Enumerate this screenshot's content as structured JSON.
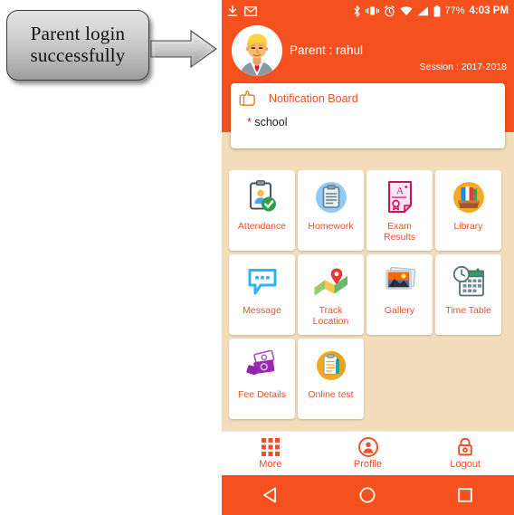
{
  "annotation": {
    "callout_text": "Parent login successfully",
    "arrow": "right-arrow"
  },
  "phone": {
    "status_bar": {
      "icons_left": [
        "download-icon",
        "gmail-icon"
      ],
      "icons_right": [
        "bluetooth-icon",
        "vibrate-icon",
        "alarm-icon",
        "wifi-icon",
        "signal-icon",
        "battery-icon"
      ],
      "battery_percent": "77%",
      "clock": "4:03 PM"
    },
    "header": {
      "avatar": "parent-avatar",
      "parent_label": "Parent : rahul",
      "session_label": "Session : 2017-2018",
      "background_color": "#f4511e"
    },
    "notification_board": {
      "icon": "pointing-hand-icon",
      "title": "Notification Board",
      "items": [
        {
          "bullet": "*",
          "text": "school"
        }
      ]
    },
    "tiles": [
      {
        "label": "Attendance",
        "icon": "clipboard-check-icon"
      },
      {
        "label": "Homework",
        "icon": "homework-clipboard-icon"
      },
      {
        "label": "Exam Results",
        "icon": "certificate-a-plus-icon"
      },
      {
        "label": "Library",
        "icon": "books-box-icon"
      },
      {
        "label": "Message",
        "icon": "speech-bubble-icon"
      },
      {
        "label": "Track Location",
        "icon": "map-pin-icon"
      },
      {
        "label": "Gallery",
        "icon": "photos-icon"
      },
      {
        "label": "Time Table",
        "icon": "calendar-clock-icon"
      },
      {
        "label": "Fee Details",
        "icon": "money-notes-icon"
      },
      {
        "label": "Online test",
        "icon": "test-clipboard-icon"
      }
    ],
    "bottom_nav": [
      {
        "label": "More",
        "icon": "grid-icon"
      },
      {
        "label": "Profile",
        "icon": "person-circle-icon"
      },
      {
        "label": "Logout",
        "icon": "padlock-icon"
      }
    ],
    "android_nav": [
      {
        "icon": "back-triangle-icon"
      },
      {
        "icon": "home-circle-icon"
      },
      {
        "icon": "recents-square-icon"
      }
    ],
    "colors": {
      "accent": "#f4511e",
      "label": "#e8512a",
      "app_background": "#f2dcba",
      "card": "#ffffff"
    }
  }
}
